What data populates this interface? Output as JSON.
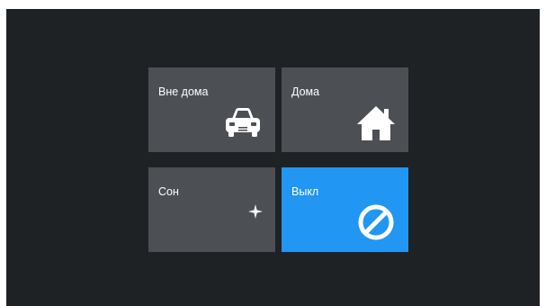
{
  "colors": {
    "screen_background": "#1f2225",
    "tile_inactive": "#4c5055",
    "tile_active": "#2196f3",
    "icon": "#ffffff"
  },
  "modes": [
    {
      "label": "Вне дома",
      "icon": "car-icon",
      "active": false
    },
    {
      "label": "Дома",
      "icon": "house-icon",
      "active": false
    },
    {
      "label": "Сон",
      "icon": "moon-star-icon",
      "active": false
    },
    {
      "label": "Выкл",
      "icon": "prohibited-icon",
      "active": true
    }
  ]
}
